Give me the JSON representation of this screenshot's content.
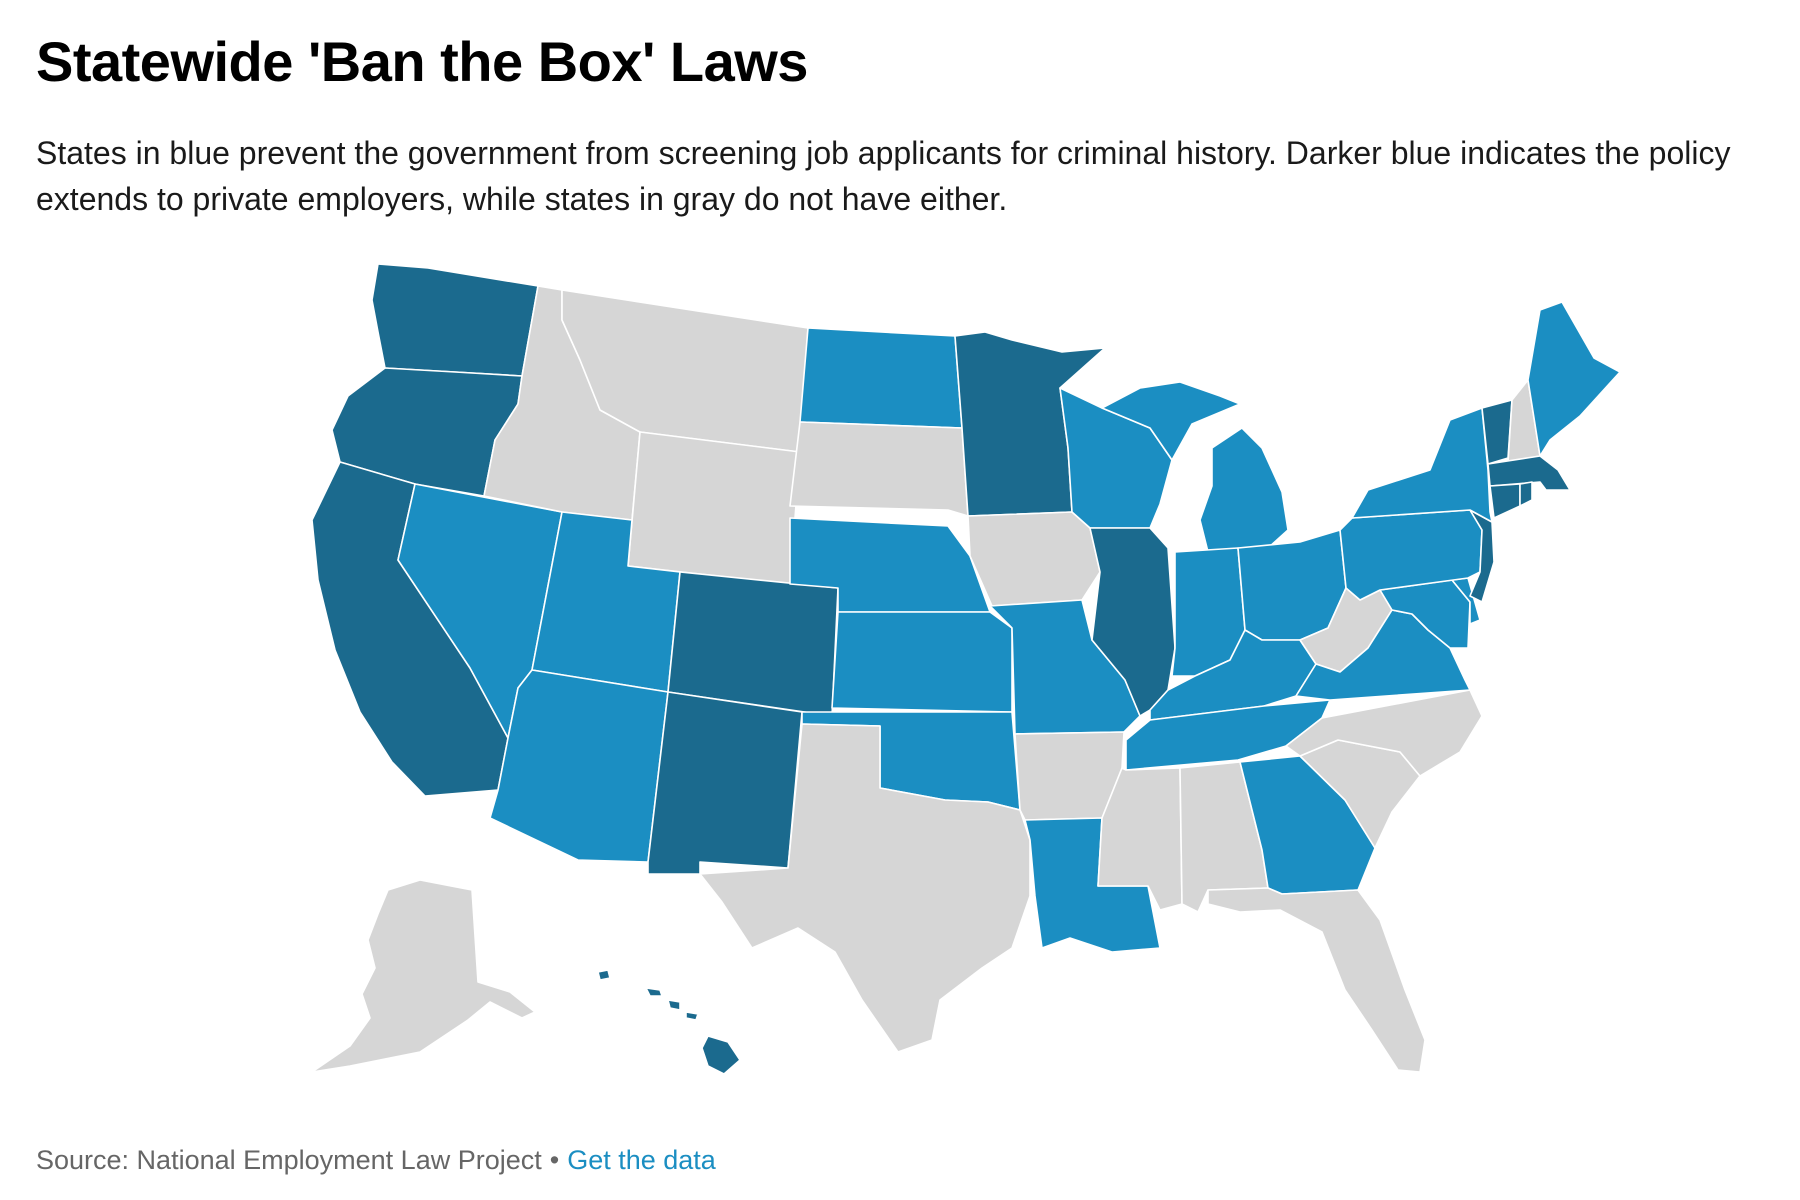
{
  "header": {
    "title": "Statewide 'Ban the Box' Laws",
    "subtitle": "States in blue prevent the government from screening job applicants for criminal history. Darker blue indicates the policy extends to private employers, while states in gray do not have either."
  },
  "footer": {
    "source": "Source: National Employment Law Project",
    "separator": "•",
    "link_label": "Get the data"
  },
  "colors": {
    "public_only": "#1b8ec2",
    "public_and_private": "#1b6a8e",
    "no_policy": "#d6d6d6",
    "border": "#ffffff",
    "link": "#1b8ec2"
  },
  "map": {
    "categories": {
      "private": [
        "WA",
        "OR",
        "CA",
        "CO",
        "NM",
        "MN",
        "IL",
        "VT",
        "MA",
        "CT",
        "RI",
        "NJ",
        "HI"
      ],
      "public": [
        "NV",
        "UT",
        "AZ",
        "ND",
        "NE",
        "KS",
        "OK",
        "LA",
        "MO",
        "WI",
        "MI",
        "IN",
        "OH",
        "KY",
        "TN",
        "GA",
        "VA",
        "PA",
        "NY",
        "DE",
        "MD",
        "ME"
      ],
      "none": [
        "ID",
        "MT",
        "WY",
        "SD",
        "TX",
        "IA",
        "AR",
        "MS",
        "AL",
        "FL",
        "SC",
        "NC",
        "WV",
        "NH",
        "AK"
      ]
    }
  }
}
